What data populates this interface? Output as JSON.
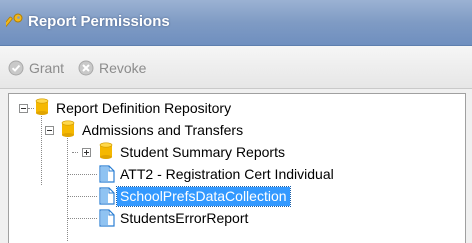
{
  "window": {
    "title": "Report Permissions",
    "title_icon": "key-icon"
  },
  "toolbar": {
    "grant_label": "Grant",
    "grant_icon": "check-circle-icon",
    "revoke_label": "Revoke",
    "revoke_icon": "x-circle-icon",
    "enabled": false
  },
  "tree": {
    "root": {
      "label": "Report Definition Repository",
      "icon": "database-icon",
      "expanded": true,
      "children": [
        {
          "label": "Admissions and Transfers",
          "icon": "database-icon",
          "expanded": true,
          "children": [
            {
              "label": "Student Summary Reports",
              "icon": "database-icon",
              "expanded": false
            },
            {
              "label": "ATT2 - Registration Cert Individual",
              "icon": "report-file-icon"
            },
            {
              "label": "SchoolPrefsDataCollection",
              "icon": "report-file-icon",
              "selected": true
            },
            {
              "label": "StudentsErrorReport",
              "icon": "report-file-icon"
            }
          ]
        }
      ]
    }
  },
  "colors": {
    "title_bar": "#7f9bc4",
    "selection": "#3399ff",
    "database_icon": "#f5b800"
  }
}
